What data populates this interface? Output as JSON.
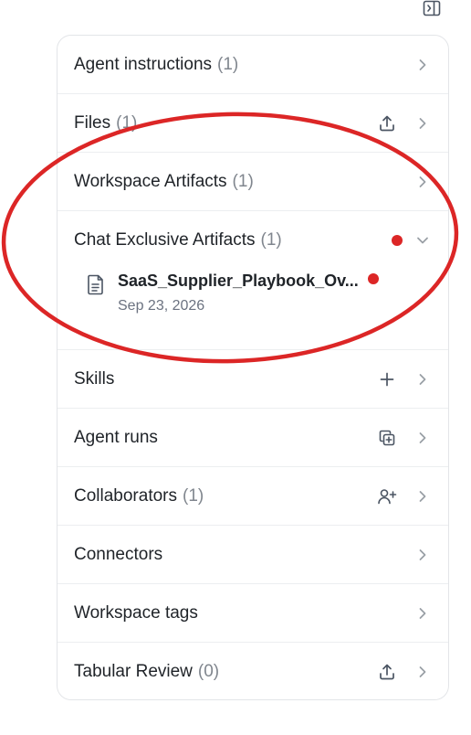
{
  "rows": [
    {
      "label": "Agent instructions",
      "count": "(1)"
    },
    {
      "label": "Files",
      "count": "(1)"
    },
    {
      "label": "Workspace Artifacts",
      "count": "(1)"
    },
    {
      "label": "Chat Exclusive Artifacts",
      "count": "(1)"
    },
    {
      "label": "Skills",
      "count": ""
    },
    {
      "label": "Agent runs",
      "count": ""
    },
    {
      "label": "Collaborators",
      "count": "(1)"
    },
    {
      "label": "Connectors",
      "count": ""
    },
    {
      "label": "Workspace tags",
      "count": ""
    },
    {
      "label": "Tabular Review",
      "count": "(0)"
    }
  ],
  "artifact": {
    "name": "SaaS_Supplier_Playbook_Ov...",
    "date": "Sep 23, 2026"
  },
  "icons": {
    "panel_toggle": "panel-right-icon",
    "upload": "upload-icon",
    "plus": "plus-icon",
    "add_copy": "copy-plus-icon",
    "add_user": "user-plus-icon",
    "chevron_right": "chevron-right-icon",
    "chevron_down": "chevron-down-icon",
    "document": "document-icon"
  },
  "colors": {
    "annotation": "#dc2626",
    "notification_dot": "#dc2626",
    "border": "#e3e5e8",
    "muted_text": "#80868e"
  }
}
